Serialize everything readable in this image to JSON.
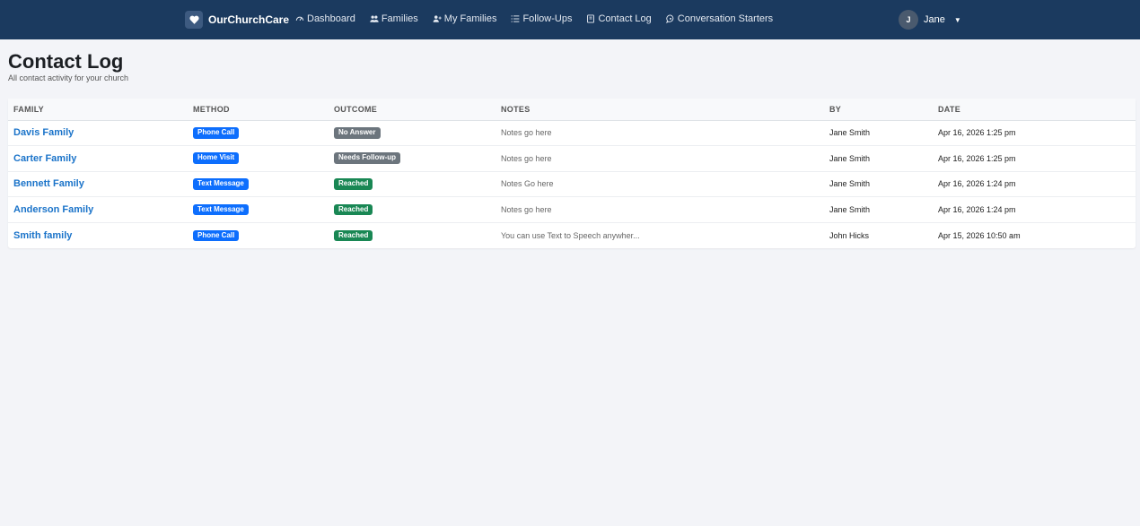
{
  "navbar": {
    "brand": "OurChurchCare",
    "links": [
      {
        "label": "Dashboard",
        "icon": "gauge-icon"
      },
      {
        "label": "Families",
        "icon": "people-icon"
      },
      {
        "label": "My Families",
        "icon": "person-plus-icon"
      },
      {
        "label": "Follow-Ups",
        "icon": "list-icon"
      },
      {
        "label": "Contact Log",
        "icon": "journal-icon"
      },
      {
        "label": "Conversation Starters",
        "icon": "chat-icon"
      }
    ],
    "user": {
      "initial": "J",
      "name": "Jane"
    }
  },
  "header": {
    "title": "Contact Log",
    "subtitle": "All contact activity for your church"
  },
  "table": {
    "columns": [
      "FAMILY",
      "METHOD",
      "OUTCOME",
      "NOTES",
      "BY",
      "DATE"
    ],
    "rows": [
      {
        "family": "Davis Family",
        "method": "Phone Call",
        "outcome": "No Answer",
        "outcome_color": "#6c757d",
        "notes": "Notes go here",
        "by": "Jane Smith",
        "date": "Apr 16, 2026 1:25 pm"
      },
      {
        "family": "Carter Family",
        "method": "Home Visit",
        "outcome": "Needs Follow-up",
        "outcome_color": "#6c757d",
        "notes": "Notes go here",
        "by": "Jane Smith",
        "date": "Apr 16, 2026 1:25 pm"
      },
      {
        "family": "Bennett Family",
        "method": "Text Message",
        "outcome": "Reached",
        "outcome_color": "#198754",
        "notes": "Notes Go here",
        "by": "Jane Smith",
        "date": "Apr 16, 2026 1:24 pm"
      },
      {
        "family": "Anderson Family",
        "method": "Text Message",
        "outcome": "Reached",
        "outcome_color": "#198754",
        "notes": "Notes go here",
        "by": "Jane Smith",
        "date": "Apr 16, 2026 1:24 pm"
      },
      {
        "family": "Smith family",
        "method": "Phone Call",
        "outcome": "Reached",
        "outcome_color": "#198754",
        "notes": "You can use Text to Speech anywher...",
        "by": "John Hicks",
        "date": "Apr 15, 2026 10:50 am"
      }
    ]
  },
  "colors": {
    "navbar": "#1b3a5f",
    "link": "#1a73c9",
    "method_badge": "#0d6efd",
    "outcome_reached": "#198754",
    "outcome_neutral": "#6c757d"
  }
}
